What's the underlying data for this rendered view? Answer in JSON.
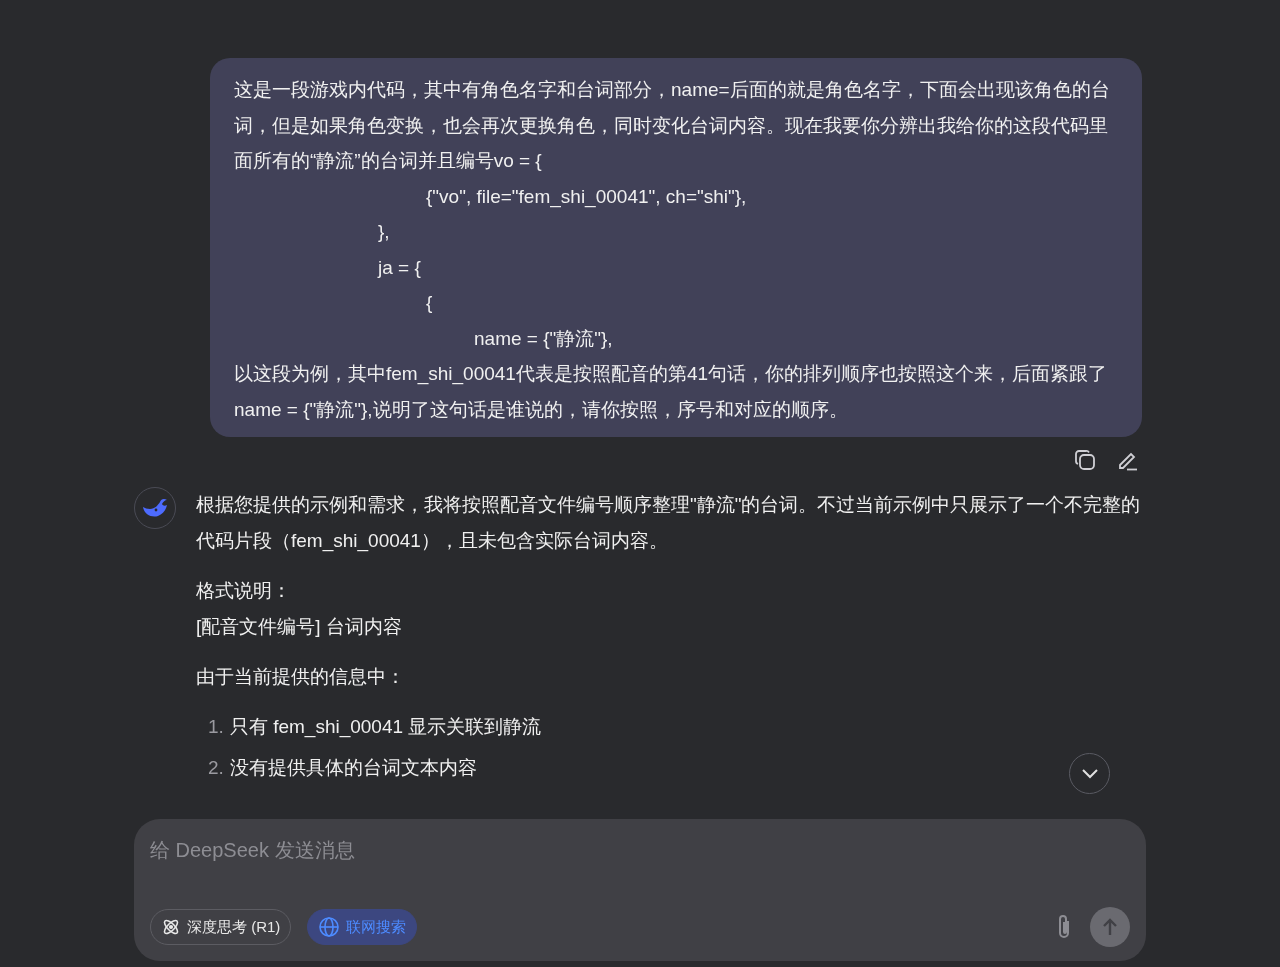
{
  "user_message": {
    "lines": [
      {
        "text": "这是一段游戏内代码，其中有角色名字和台词部分，name=后面的就是角色名字，下面会出现该角色的台词，但是如果角色变换，也会再次更换角色，同时变化台词内容。现在我要你分辨出我给你的这段代码里面所有的“静流”的台词并且编号vo = {"
      },
      {
        "text": "\t\t\t\t{\"vo\", file=\"fem_shi_00041\", ch=\"shi\"},"
      },
      {
        "text": "\t\t\t},"
      },
      {
        "text": "\t\t\tja = {"
      },
      {
        "text": "\t\t\t\t{"
      },
      {
        "text": "\t\t\t\t\tname = {\"静流\"},"
      },
      {
        "text": "以这段为例，其中fem_shi_00041代表是按照配音的第41句话，你的排列顺序也按照这个来，后面紧跟了name = {\"静流\"},说明了这句话是谁说的，请你按照，序号和对应的顺序。"
      }
    ]
  },
  "assistant_message": {
    "blocks": [
      {
        "kind": "paragraph",
        "lines": [
          "根据您提供的示例和需求，我将按照配音文件编号顺序整理\"静流\"的台词。不过当前示例中只展示了一个不完整的代码片段（fem_shi_00041），且未包含实际台词内容。"
        ]
      },
      {
        "kind": "paragraph",
        "lines": [
          "格式说明：",
          "[配音文件编号] 台词内容"
        ]
      },
      {
        "kind": "paragraph",
        "lines": [
          "由于当前提供的信息中："
        ]
      },
      {
        "kind": "list",
        "items": [
          {
            "number": "1.",
            "text": "只有 fem_shi_00041 显示关联到静流"
          },
          {
            "number": "2.",
            "text": "没有提供具体的台词文本内容"
          }
        ]
      }
    ]
  },
  "composer": {
    "placeholder": "给 DeepSeek 发送消息",
    "toggles": [
      {
        "kind": "think",
        "label": "深度思考 (R1)",
        "selected": false
      },
      {
        "kind": "search",
        "label": "联网搜索",
        "selected": true
      }
    ],
    "send_disabled": true
  }
}
